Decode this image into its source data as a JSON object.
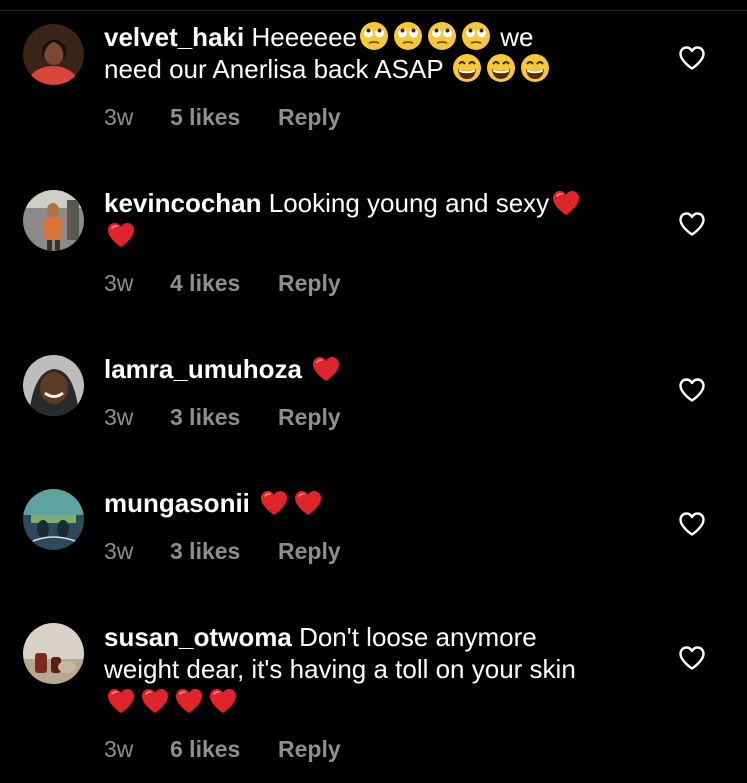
{
  "colors": {
    "background": "#000000",
    "text": "#ffffff",
    "meta": "#8e8e8e",
    "heart": "#e0242c"
  },
  "comments": [
    {
      "username": "velvet_haki",
      "text_1": "Heeeeee",
      "text_2": "we",
      "text_3": "need our Anerlisa back ASAP",
      "time": "3w",
      "likes": "5 likes",
      "reply": "Reply",
      "emojis": [
        "face-with-rolling-eyes",
        "face-with-rolling-eyes",
        "face-with-rolling-eyes",
        "face-with-rolling-eyes",
        "grinning-face-with-smiling-eyes",
        "grinning-face-with-smiling-eyes",
        "grinning-face-with-smiling-eyes"
      ]
    },
    {
      "username": "kevincochan",
      "text_1": "Looking young and sexy",
      "time": "3w",
      "likes": "4 likes",
      "reply": "Reply",
      "emojis": [
        "red-heart",
        "red-heart"
      ]
    },
    {
      "username": "lamra_umuhoza",
      "text_1": "",
      "time": "3w",
      "likes": "3 likes",
      "reply": "Reply",
      "emojis": [
        "red-heart"
      ]
    },
    {
      "username": "mungasonii",
      "text_1": "",
      "time": "3w",
      "likes": "3 likes",
      "reply": "Reply",
      "emojis": [
        "red-heart",
        "red-heart"
      ]
    },
    {
      "username": "susan_otwoma",
      "text_1": "Don't loose anymore",
      "text_2": "weight dear, it's having a toll on your skin",
      "time": "3w",
      "likes": "6 likes",
      "reply": "Reply",
      "emojis": [
        "red-heart",
        "red-heart",
        "red-heart",
        "red-heart"
      ]
    }
  ]
}
